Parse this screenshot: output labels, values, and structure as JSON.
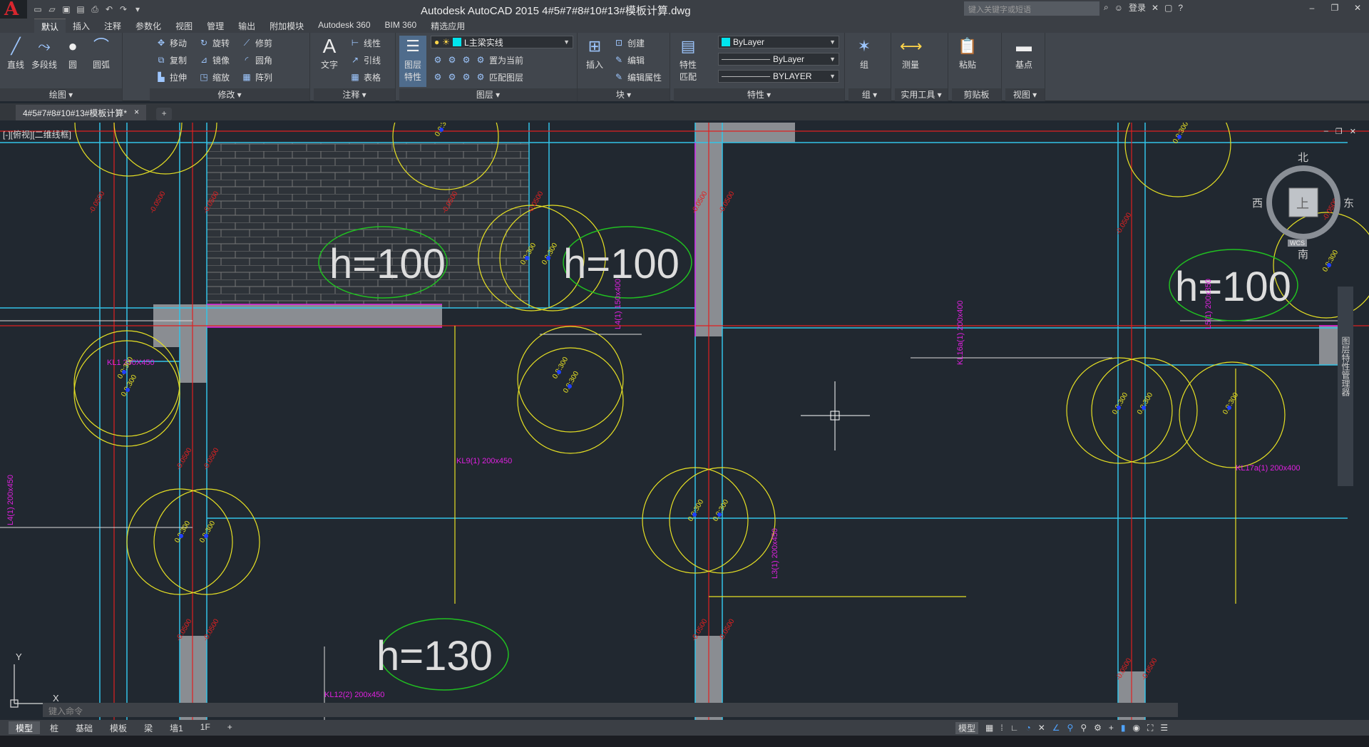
{
  "window": {
    "title": "Autodesk AutoCAD 2015    4#5#7#8#10#13#模板计算.dwg",
    "search_placeholder": "键入关键字或短语",
    "login_label": "登录"
  },
  "ribbon_tabs": [
    "默认",
    "插入",
    "注释",
    "参数化",
    "视图",
    "管理",
    "输出",
    "附加模块",
    "Autodesk 360",
    "BIM 360",
    "精选应用"
  ],
  "panels": {
    "draw": {
      "title": "绘图 ▾",
      "line": "直线",
      "polyline": "多段线",
      "circle": "圆",
      "arc": "圆弧"
    },
    "modify": {
      "title": "修改 ▾",
      "move": "移动",
      "rotate": "旋转",
      "trim": "修剪",
      "copy": "复制",
      "mirror": "镜像",
      "fillet": "圆角",
      "stretch": "拉伸",
      "scale": "缩放",
      "array": "阵列"
    },
    "annotation": {
      "title": "注释 ▾",
      "text": "文字",
      "linear": "线性",
      "leader": "引线",
      "table": "表格"
    },
    "layers": {
      "title": "图层 ▾",
      "layer_props": "图层\n特性",
      "current_layer": "L主梁实线",
      "set_current": "置为当前",
      "match_layer": "匹配图层"
    },
    "block": {
      "title": "块 ▾",
      "insert": "插入",
      "create": "创建",
      "edit": "编辑",
      "edit_attr": "编辑属性"
    },
    "properties": {
      "title": "特性 ▾",
      "match": "特性\n匹配",
      "color": "ByLayer",
      "linetype": "ByLayer",
      "lineweight": "BYLAYER"
    },
    "group": {
      "title": "组 ▾",
      "group": "组"
    },
    "utilities": {
      "title": "实用工具 ▾",
      "measure": "测量"
    },
    "clipboard": {
      "title": "剪贴板",
      "paste": "粘贴"
    },
    "view": {
      "title": "视图 ▾",
      "base": "基点"
    }
  },
  "doc_tab": {
    "label": "4#5#7#8#10#13#模板计算*",
    "close": "×"
  },
  "viewport_label": "[-][俯视][二维线框]",
  "viewcube": {
    "n": "北",
    "s": "南",
    "e": "东",
    "w": "西",
    "top": "上",
    "wcs": "WCS"
  },
  "drawing": {
    "slab_labels": [
      "h=100",
      "h=100",
      "h=100",
      "h=130"
    ],
    "beam_labels": [
      "KL1 200X450",
      "KL9(1) 200x450",
      "L4(1) 150x400",
      "KL16a(1) 200x400",
      "L5(1) 200x350",
      "L4(1) 200x450",
      "L3(1) 200x450",
      "KL17a(1) 200x400",
      "KL12(2) 200x450"
    ],
    "elev_label": "-0.0500",
    "bar_label": "0.8:300"
  },
  "command_placeholder": "键入命令",
  "layout_tabs": [
    "模型",
    "桩",
    "基础",
    "模板",
    "梁",
    "墙1",
    "1F"
  ],
  "status": {
    "model": "模型"
  },
  "side_palette": "图层特性管理器",
  "ucs": {
    "x": "X",
    "y": "Y"
  }
}
